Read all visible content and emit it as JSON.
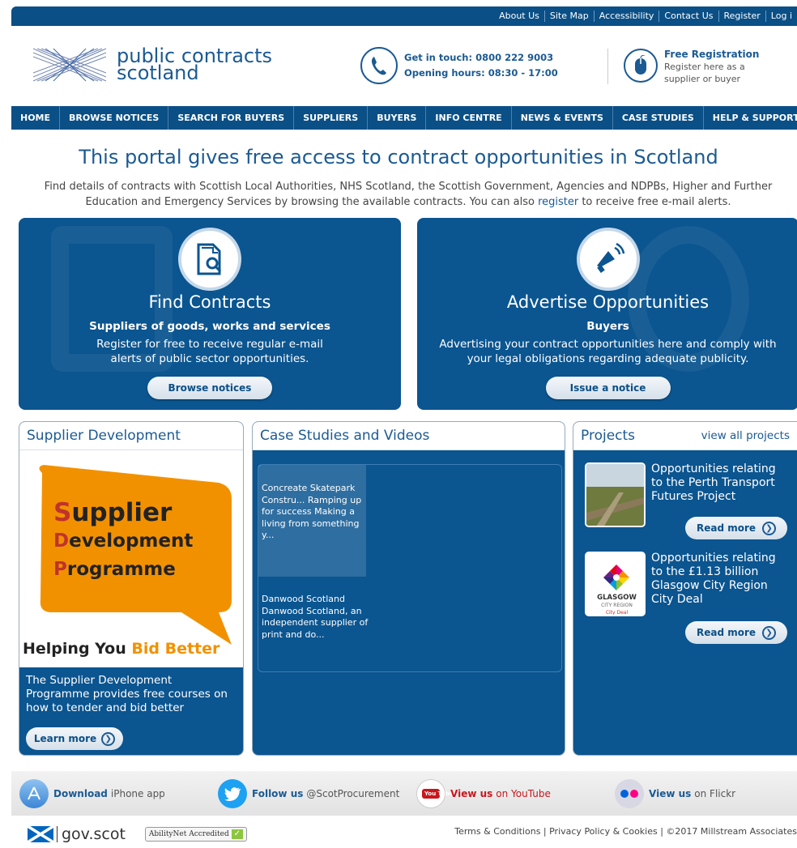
{
  "topbar": {
    "links": [
      "About Us",
      "Site Map",
      "Accessibility",
      "Contact Us",
      "Register",
      "Log i"
    ]
  },
  "header": {
    "logo_line1": "public contracts",
    "logo_line2": "scotland",
    "contact_line1": "Get in touch: 0800 222 9003",
    "contact_line2": "Opening hours: 08:30 - 17:00",
    "reg_title": "Free Registration",
    "reg_line1": "Register here as a",
    "reg_line2": "supplier or buyer"
  },
  "nav": {
    "items": [
      "HOME",
      "BROWSE NOTICES",
      "SEARCH FOR BUYERS",
      "SUPPLIERS",
      "BUYERS",
      "INFO CENTRE",
      "NEWS & EVENTS",
      "CASE STUDIES",
      "HELP & SUPPORT"
    ]
  },
  "intro": {
    "headline": "This portal gives free access to contract opportunities in Scotland",
    "text_before": "Find details of contracts with Scottish Local Authorities, NHS Scotland, the Scottish Government, Agencies and NDPBs, Higher and Further Education and Emergency Services by browsing the available contracts. You can also ",
    "link": "register",
    "text_after": " to receive free e-mail alerts."
  },
  "hero": {
    "find": {
      "title": "Find Contracts",
      "sub": "Suppliers of goods, works and services",
      "desc_line1": "Register for free to receive regular e-mail",
      "desc_line2": "alerts of public sector opportunities.",
      "button": "Browse notices"
    },
    "advertise": {
      "title": "Advertise Opportunities",
      "sub": "Buyers",
      "desc_line1": "Advertising your contract opportunities here and comply with",
      "desc_line2": "your legal obligations regarding adequate publicity.",
      "button": "Issue a notice"
    }
  },
  "supplier_dev": {
    "heading": "Supplier Development",
    "img_l1_cap": "S",
    "img_l1_rest": "upplier",
    "img_l2_cap": "D",
    "img_l2_rest": "evelopment",
    "img_l3_cap": "P",
    "img_l3_rest": "rogramme",
    "img_tag_a": "Helping You ",
    "img_tag_b": "Bid Better",
    "desc": "The Supplier Development Programme provides free courses on how to tender and bid better",
    "button": "Learn more"
  },
  "case_studies": {
    "heading": "Case Studies and Videos",
    "items": [
      {
        "text": "Concreate Skatepark Constru... Ramping up for success Making a living from something y..."
      },
      {
        "text": "Danwood Scotland Danwood Scotland, an independent supplier of print and do..."
      }
    ]
  },
  "projects": {
    "heading": "Projects",
    "view_all": "view all projects",
    "items": [
      {
        "text": "Opportunities relating to the Perth Transport Futures Project",
        "button": "Read more"
      },
      {
        "text": "Opportunities relating to the £1.13 billion Glasgow City Region City Deal",
        "button": "Read more"
      }
    ],
    "glasgow_logo_l1": "GLASGOW",
    "glasgow_logo_l2": "CITY REGION",
    "glasgow_logo_l3": "City Deal"
  },
  "social": {
    "iphone_b": "Download",
    "iphone_t": "iPhone app",
    "twitter_b": "Follow us",
    "twitter_t": "@ScotProcurement",
    "youtube_b": "View us",
    "youtube_t": "on YouTube",
    "youtube_logo": "You Tube",
    "flickr_b": "View us",
    "flickr_t": "on Flickr"
  },
  "footer": {
    "govscot": "gov.scot",
    "ability": "AbilityNet Accredited",
    "links": "Terms & Conditions | Privacy Policy & Cookies | ©2017 Millstream Associates"
  },
  "colors": {
    "brand_blue": "#0b5590",
    "nav_blue": "#0a4f86",
    "accent_orange": "#f29100",
    "youtube_red": "#c8161d"
  }
}
